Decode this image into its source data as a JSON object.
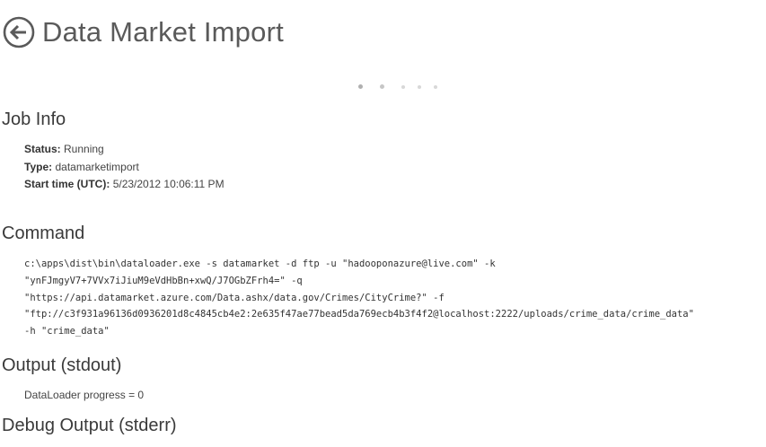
{
  "header": {
    "back_icon": "back-arrow-circle-icon",
    "title": "Data Market Import"
  },
  "pager": {
    "count": 5,
    "active_index": 0
  },
  "job_info": {
    "heading": "Job Info",
    "status_label": "Status:",
    "status_value": "Running",
    "type_label": "Type:",
    "type_value": "datamarketimport",
    "start_label": "Start time (UTC):",
    "start_value": "5/23/2012 10:06:11 PM"
  },
  "command": {
    "heading": "Command",
    "lines": [
      "c:\\apps\\dist\\bin\\dataloader.exe -s datamarket -d ftp -u \"hadooponazure@live.com\" -k",
      "\"ynFJmgyV7+7VVx7iJiuM9eVdHbBn+xwQ/J7OGbZFrh4=\" -q",
      "\"https://api.datamarket.azure.com/Data.ashx/data.gov/Crimes/CityCrime?\" -f",
      "\"ftp://c3f931a96136d0936201d8c4845cb4e2:2e635f47ae77bead5da769ecb4b3f4f2@localhost:2222/uploads/crime_data/crime_data\"",
      "-h \"crime_data\""
    ]
  },
  "output": {
    "heading": "Output (stdout)",
    "text": "DataLoader progress = 0"
  },
  "debug": {
    "heading": "Debug Output (stderr)"
  }
}
